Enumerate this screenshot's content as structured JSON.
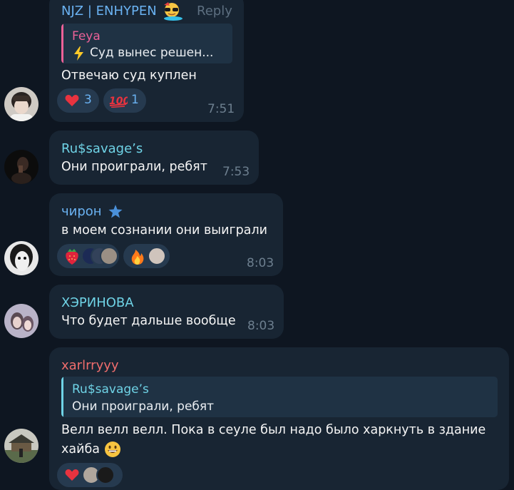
{
  "messages": [
    {
      "sender": "NJZ | ENHYPEN",
      "sender_badge_icon": "sunglasses-emoji-icon",
      "reply_label": "Reply",
      "quote": {
        "author": "Feya",
        "icon": "lightning-icon",
        "text": "Суд вынес решен..."
      },
      "text": "Отвечаю суд куплен",
      "reactions": [
        {
          "icon": "heart-icon",
          "count": "3"
        },
        {
          "icon": "hundred-points-icon",
          "count": "1"
        }
      ],
      "time": "7:51"
    },
    {
      "sender": "Ru$savage’s",
      "text": "Они проиграли, ребят",
      "time": "7:53"
    },
    {
      "sender": "чирон",
      "sender_badge_icon": "star-icon",
      "text": "в моем сознании они выиграли",
      "reactions": [
        {
          "icon": "strawberry-icon",
          "reactors": 3
        },
        {
          "icon": "fire-icon",
          "reactors": 1
        }
      ],
      "time": "8:03"
    },
    {
      "sender": "ХЭРИНОВА",
      "text": "Что будет дальше вообще",
      "time": "8:03"
    },
    {
      "sender": "xarlrryyy",
      "quote": {
        "author": "Ru$savage’s",
        "text": "Они проиграли, ребят"
      },
      "text_line1": "Велл велл велл. Пока в сеуле был надо было харкнуть в здание",
      "text_line2": "хайба",
      "emoji_icon": "grinning-face-icon",
      "reactions": [
        {
          "icon": "heart-icon",
          "reactors": 2
        }
      ]
    }
  ],
  "colors": {
    "background": "#0e1621",
    "bubble": "#182533",
    "reaction_bg": "#263a4f",
    "sender_blue": "#6ab2f2",
    "sender_cyan": "#6fd3e6",
    "sender_pink": "#ec6198",
    "sender_red": "#ef6d6d",
    "timestamp": "#6d7f8f"
  }
}
